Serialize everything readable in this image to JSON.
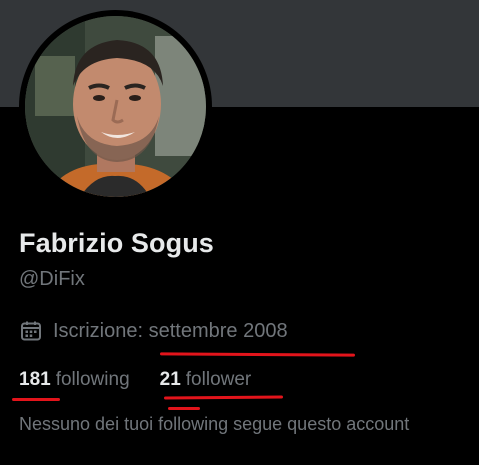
{
  "profile": {
    "name": "Fabrizio Sogus",
    "handle": "@DiFix",
    "joined": "Iscrizione: settembre 2008",
    "following_count": "181",
    "following_label": "following",
    "followers_count": "21",
    "followers_label": "follower",
    "mutuals_note": "Nessuno dei tuoi following segue questo account"
  },
  "icons": {
    "calendar": "calendar-icon"
  },
  "colors": {
    "background": "#000000",
    "banner": "#333639",
    "primary_text": "#e7e9ea",
    "secondary_text": "#71767b",
    "annotation_red": "#e3141b"
  }
}
